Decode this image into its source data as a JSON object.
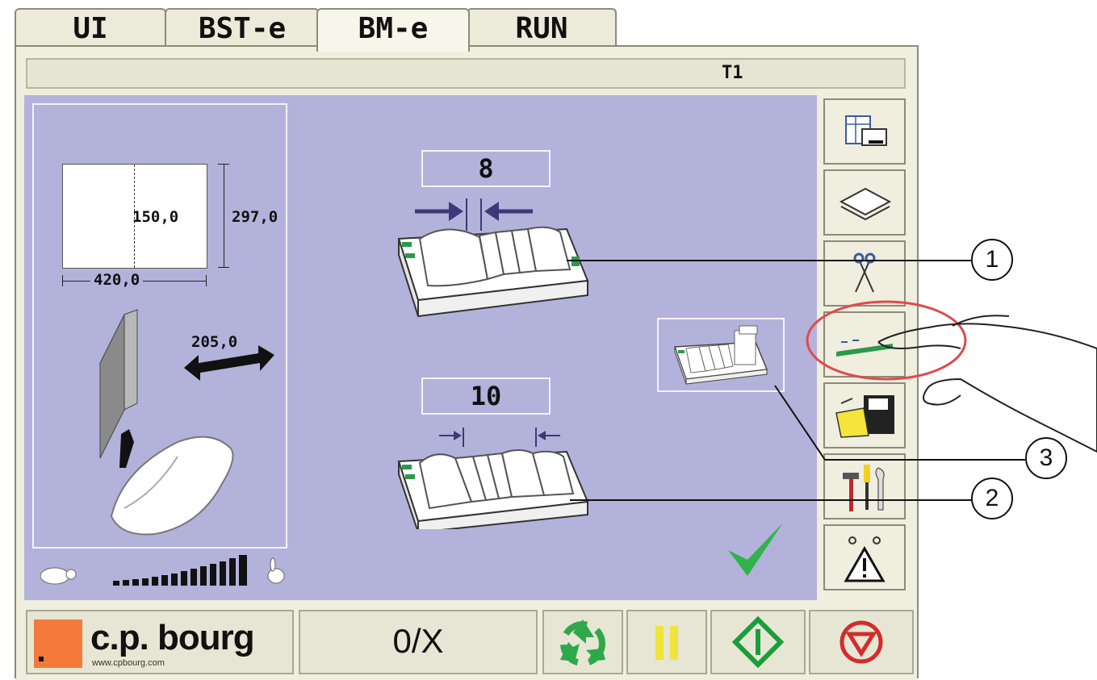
{
  "tabs": [
    {
      "label": "UI"
    },
    {
      "label": "BST-e"
    },
    {
      "label": "BM-e"
    },
    {
      "label": "RUN"
    }
  ],
  "active_tab": "BM-e",
  "title_bar": {
    "label": "T1"
  },
  "sheet": {
    "width": "420,0",
    "height": "297,0",
    "fold": "150,0"
  },
  "cover_width": "205,0",
  "spacing": {
    "large": "8",
    "small": "10"
  },
  "speed_level": 1.0,
  "callouts": [
    "1",
    "2",
    "3"
  ],
  "brand": {
    "name": "c.p. bourg",
    "url": "www.cpbourg.com",
    "accent": "#f47a3a"
  },
  "counter": {
    "value": "0/X"
  },
  "side_buttons": [
    "layout-icon",
    "paper-icon",
    "scissors-icon",
    "spine-icon",
    "save-folder-icon",
    "tools-icon",
    "warning-icon"
  ],
  "colors": {
    "panel": "#b3b2db",
    "frame": "#efeedf",
    "check": "#2fb34a",
    "start": "#1a9e3a",
    "stop": "#d12d2d",
    "pause": "#f0e43a",
    "highlight": "#e04a4a"
  }
}
